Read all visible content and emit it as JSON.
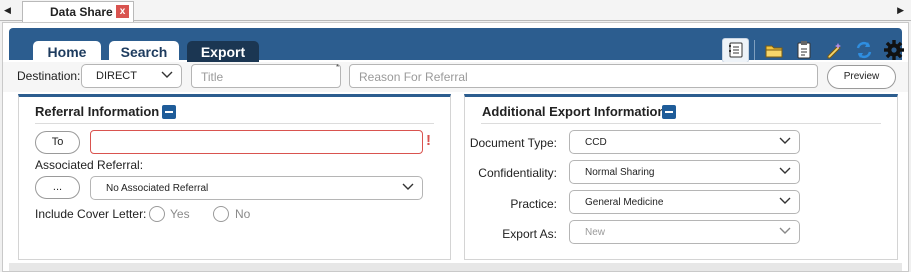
{
  "window_tab": {
    "title": "Data Share",
    "close_glyph": "x"
  },
  "nav": {
    "tabs": [
      {
        "label": "Home"
      },
      {
        "label": "Search"
      },
      {
        "label": "Export"
      }
    ],
    "active": "Export"
  },
  "toolbar": {
    "icons": [
      "notebook-icon",
      "folder-icon",
      "clipboard-icon",
      "pencil-sparkle-icon",
      "refresh-icon",
      "gear-icon"
    ]
  },
  "destination": {
    "label": "Destination:",
    "selected": "DIRECT",
    "title_placeholder": "Title",
    "title_marker": "*",
    "reason_placeholder": "Reason For Referral",
    "preview_label": "Preview"
  },
  "referral": {
    "title": "Referral Information",
    "to_button": "To",
    "to_value": "",
    "required_mark": "!",
    "associated_label": "Associated Referral:",
    "associated_button": "...",
    "associated_selected": "No Associated Referral",
    "cover_letter_label": "Include Cover Letter:",
    "yes_label": "Yes",
    "no_label": "No"
  },
  "export_info": {
    "title": "Additional Export Information",
    "document_type_label": "Document Type:",
    "document_type_value": "CCD",
    "confidentiality_label": "Confidentiality:",
    "confidentiality_value": "Normal Sharing",
    "practice_label": "Practice:",
    "practice_value": "General Medicine",
    "export_as_label": "Export As:",
    "export_as_value": "New"
  },
  "colors": {
    "header_blue": "#2c5d8f",
    "active_tab": "#1b3652",
    "error_red": "#d9534f",
    "toggle_blue": "#1f5c99"
  }
}
